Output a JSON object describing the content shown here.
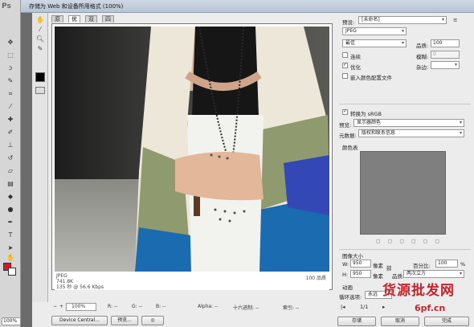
{
  "window": {
    "title": "存储为 Web 和设备所用格式 (100%)",
    "ps_logo": "Ps",
    "doc_zoom": "100%"
  },
  "tabs": [
    {
      "label": "原稿"
    },
    {
      "label": "优化"
    },
    {
      "label": "双联"
    },
    {
      "label": "四联"
    }
  ],
  "preview": {
    "format": "JPEG",
    "file_size": "741.8K",
    "time": "135 秒 @ 56.6 Kbps",
    "quality_info": "100 品质"
  },
  "status_bar": {
    "zoom": "100%",
    "r": "R:  --",
    "g": "G:  --",
    "b": "B:  --",
    "alpha": "Alpha:  --",
    "hex": "十六进制:  --",
    "index": "索引:  --"
  },
  "buttons": {
    "device_central": "Device Central...",
    "preview": "预览...",
    "save": "存储",
    "cancel": "取消",
    "done": "完成"
  },
  "settings": {
    "preset_label": "预设:",
    "preset_value": "[未命名]",
    "format_value": "JPEG",
    "quality_preset": "最佳",
    "quality_label": "品质:",
    "quality_value": "100",
    "progressive_label": "连续",
    "blur_label": "模糊:",
    "blur_value": "0",
    "optimized_label": "优化",
    "matte_label": "杂边:",
    "embed_profile_label": "嵌入颜色配置文件",
    "convert_srgb_label": "转换为 sRGB",
    "preview_label": "预览:",
    "preview_value": "显示器颜色",
    "metadata_label": "元数据:",
    "metadata_value": "版权和联系信息",
    "color_table_label": "颜色表",
    "image_size_label": "图像大小",
    "width_label": "W:",
    "width_value": "950",
    "height_label": "H:",
    "height_value": "950",
    "pixels_unit": "像素",
    "percent_label": "百分比:",
    "percent_value": "100",
    "percent_unit": "%",
    "resample_label": "品质:",
    "resample_value": "两次立方",
    "animation_label": "动画",
    "loop_label": "循环选项:",
    "loop_value": "永远",
    "frame_counter": "1/1"
  },
  "watermark": {
    "text": "货源批发网",
    "url": "6pf.cn"
  },
  "colors": {
    "accent_red": "#d8182b",
    "watermark": "#c8232b"
  }
}
